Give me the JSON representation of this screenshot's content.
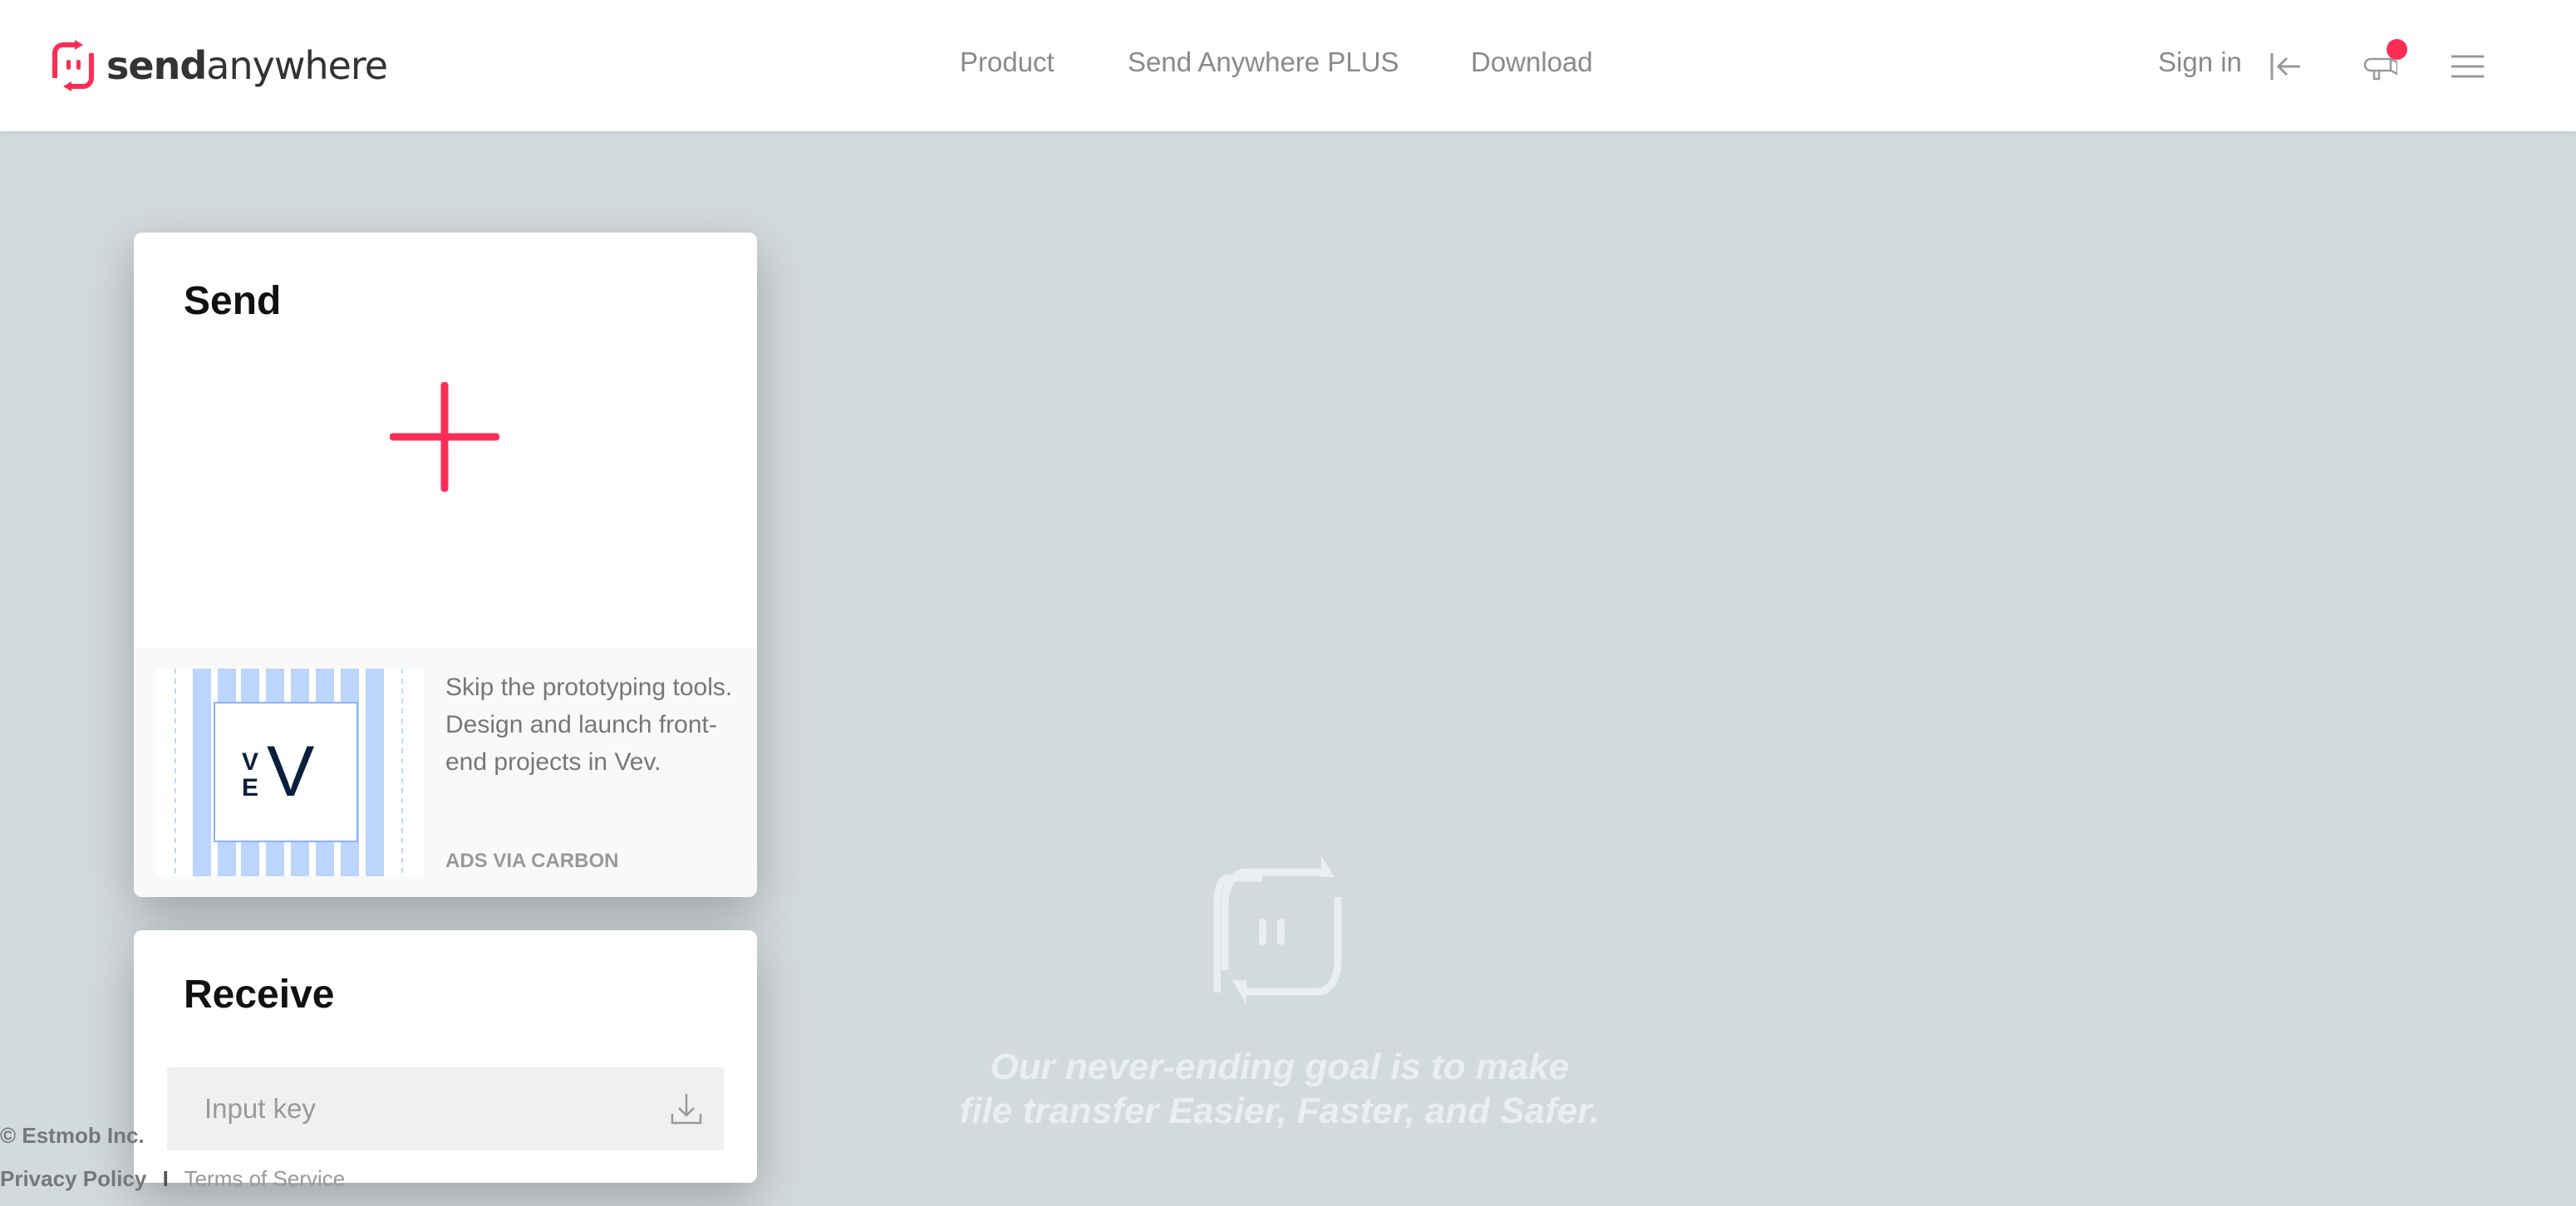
{
  "header": {
    "brand": {
      "bold": "send",
      "light": "anywhere"
    },
    "nav": [
      {
        "label": "Product"
      },
      {
        "label": "Send Anywhere PLUS"
      },
      {
        "label": "Download"
      }
    ],
    "sign_in": "Sign in",
    "icons": [
      "sign-in-icon",
      "megaphone-icon",
      "menu-icon"
    ],
    "notification_dot_color": "#ff2d55"
  },
  "send": {
    "title": "Send",
    "add_icon": "plus-icon",
    "accent": "#ff2d55",
    "ad": {
      "logo_text": "VEV",
      "text": "Skip the prototyping tools. Design and launch front-end projects in Vev.",
      "via": "ADS VIA CARBON"
    }
  },
  "receive": {
    "title": "Receive",
    "placeholder": "Input key",
    "value": ""
  },
  "footer": {
    "copyright": "© Estmob Inc.",
    "privacy": "Privacy Policy",
    "separator": "I",
    "terms": "Terms of Service"
  },
  "hero": {
    "line1": "Our never-ending goal is to make",
    "line2": "file transfer Easier, Faster, and Safer."
  }
}
